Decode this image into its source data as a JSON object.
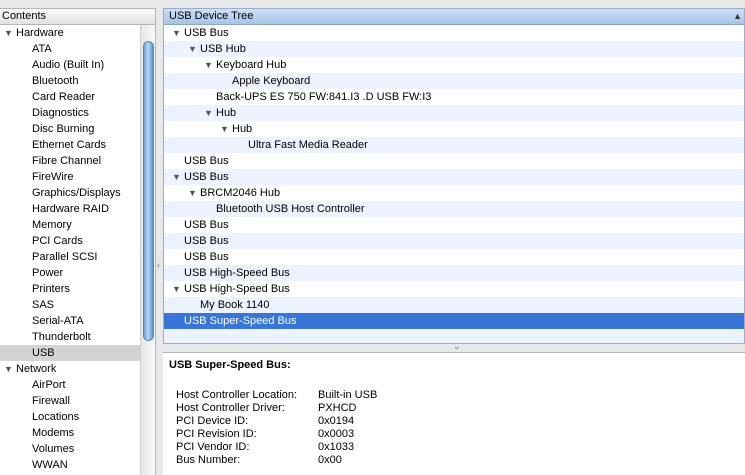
{
  "sidebar": {
    "header": "Contents",
    "groups": [
      {
        "label": "Hardware",
        "items": [
          "ATA",
          "Audio (Built In)",
          "Bluetooth",
          "Card Reader",
          "Diagnostics",
          "Disc Burning",
          "Ethernet Cards",
          "Fibre Channel",
          "FireWire",
          "Graphics/Displays",
          "Hardware RAID",
          "Memory",
          "PCI Cards",
          "Parallel SCSI",
          "Power",
          "Printers",
          "SAS",
          "Serial-ATA",
          "Thunderbolt",
          "USB"
        ]
      },
      {
        "label": "Network",
        "items": [
          "AirPort",
          "Firewall",
          "Locations",
          "Modems",
          "Volumes",
          "WWAN"
        ]
      }
    ],
    "selected": "USB"
  },
  "tree": {
    "header": "USB Device Tree",
    "rows": [
      {
        "label": "USB Bus",
        "depth": 0,
        "expandable": true
      },
      {
        "label": "USB Hub",
        "depth": 1,
        "expandable": true
      },
      {
        "label": "Keyboard Hub",
        "depth": 2,
        "expandable": true
      },
      {
        "label": "Apple Keyboard",
        "depth": 3,
        "expandable": false
      },
      {
        "label": "Back-UPS ES 750 FW:841.I3 .D USB FW:I3",
        "depth": 2,
        "expandable": false
      },
      {
        "label": "Hub",
        "depth": 2,
        "expandable": true
      },
      {
        "label": "Hub",
        "depth": 3,
        "expandable": true
      },
      {
        "label": "Ultra Fast Media Reader",
        "depth": 4,
        "expandable": false
      },
      {
        "label": "USB Bus",
        "depth": 0,
        "expandable": false
      },
      {
        "label": "USB Bus",
        "depth": 0,
        "expandable": true
      },
      {
        "label": "BRCM2046 Hub",
        "depth": 1,
        "expandable": true
      },
      {
        "label": "Bluetooth USB Host Controller",
        "depth": 2,
        "expandable": false
      },
      {
        "label": "USB Bus",
        "depth": 0,
        "expandable": false
      },
      {
        "label": "USB Bus",
        "depth": 0,
        "expandable": false
      },
      {
        "label": "USB Bus",
        "depth": 0,
        "expandable": false
      },
      {
        "label": "USB High-Speed Bus",
        "depth": 0,
        "expandable": false
      },
      {
        "label": "USB High-Speed Bus",
        "depth": 0,
        "expandable": true
      },
      {
        "label": "My Book 1140",
        "depth": 1,
        "expandable": false
      },
      {
        "label": "USB Super-Speed Bus",
        "depth": 0,
        "expandable": false,
        "selected": true
      }
    ]
  },
  "detail": {
    "title": "USB Super-Speed Bus:",
    "properties": [
      {
        "key": "Host Controller Location:",
        "value": "Built-in USB"
      },
      {
        "key": "Host Controller Driver:",
        "value": "PXHCD"
      },
      {
        "key": "PCI Device ID:",
        "value": "0x0194"
      },
      {
        "key": "PCI Revision ID:",
        "value": "0x0003"
      },
      {
        "key": "PCI Vendor ID:",
        "value": "0x1033"
      },
      {
        "key": "Bus Number:",
        "value": "0x00"
      }
    ]
  },
  "icons": {
    "expanded": "disclosure-triangle-down-icon",
    "sort": "sort-ascending-icon"
  }
}
